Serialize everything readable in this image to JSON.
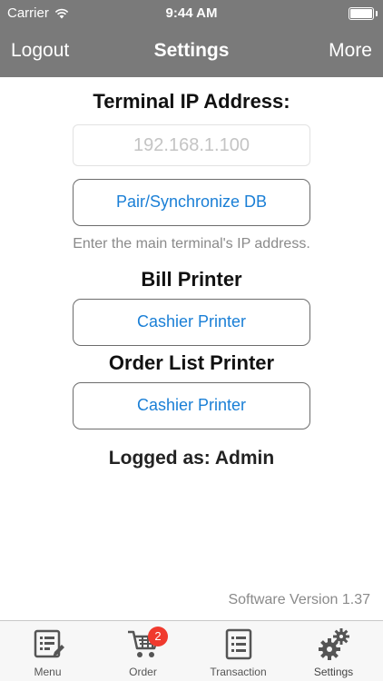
{
  "status_bar": {
    "carrier": "Carrier",
    "time": "9:44 AM"
  },
  "nav": {
    "left": "Logout",
    "title": "Settings",
    "right": "More"
  },
  "terminal": {
    "heading": "Terminal IP Address:",
    "ip_placeholder": "192.168.1.100",
    "ip_value": "",
    "sync_button": "Pair/Synchronize DB",
    "hint": "Enter the main terminal's IP address."
  },
  "bill_printer": {
    "heading": "Bill Printer",
    "selected": "Cashier Printer"
  },
  "order_list_printer": {
    "heading": "Order List Printer",
    "selected": "Cashier Printer"
  },
  "logged_as": "Logged as: Admin",
  "version": "Software Version 1.37",
  "tabs": [
    {
      "label": "Menu",
      "icon": "menu-icon"
    },
    {
      "label": "Order",
      "icon": "cart-icon",
      "badge": "2"
    },
    {
      "label": "Transaction",
      "icon": "transaction-icon"
    },
    {
      "label": "Settings",
      "icon": "gear-icon"
    }
  ],
  "colors": {
    "bar": "#7a7a7a",
    "link_text": "#1a7fd6",
    "badge": "#f03a2e"
  }
}
